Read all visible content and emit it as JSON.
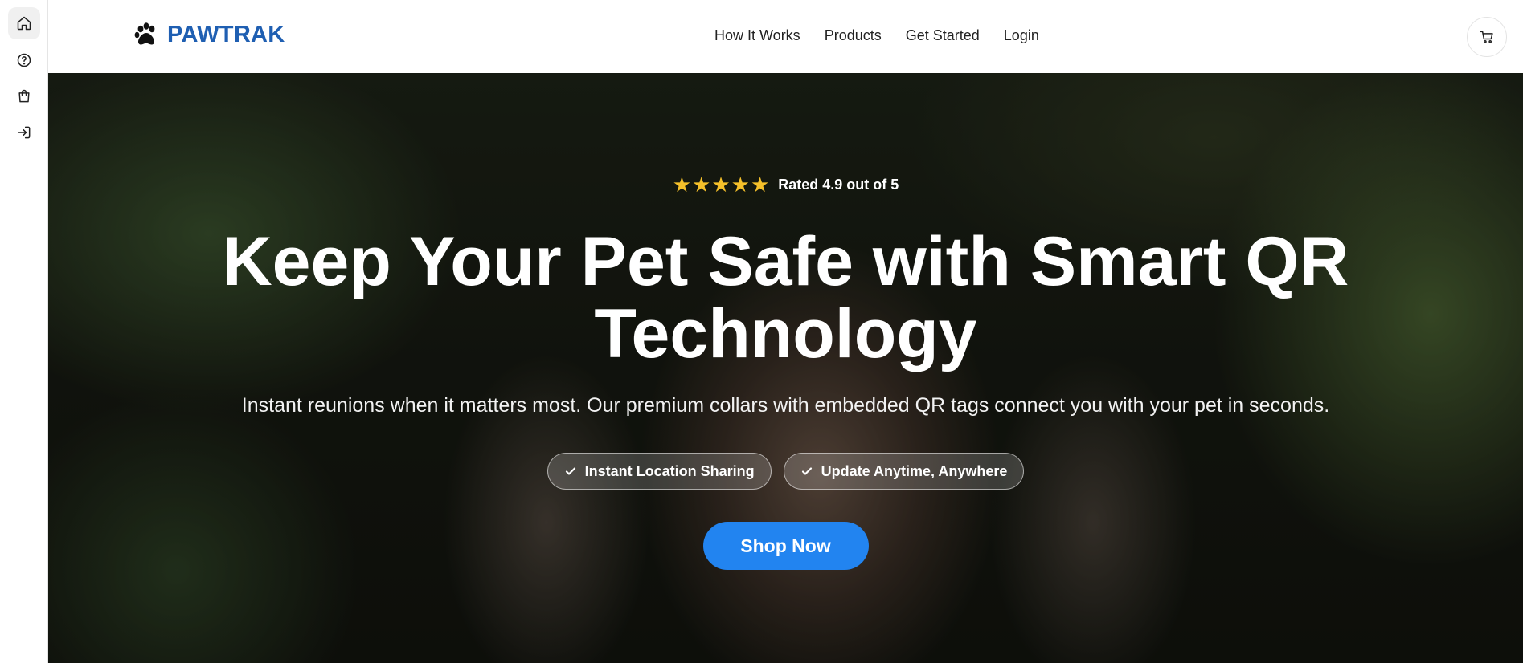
{
  "sidebar": {
    "items": [
      {
        "icon": "home-icon",
        "active": true
      },
      {
        "icon": "help-circle-icon",
        "active": false
      },
      {
        "icon": "shopping-bag-icon",
        "active": false
      },
      {
        "icon": "login-icon",
        "active": false
      }
    ]
  },
  "header": {
    "brand_name": "PAWTRAK",
    "brand_icon": "paw-icon",
    "brand_color": "#1f5fb2",
    "nav": [
      {
        "label": "How It Works"
      },
      {
        "label": "Products"
      },
      {
        "label": "Get Started"
      },
      {
        "label": "Login"
      }
    ],
    "cart_icon": "cart-icon"
  },
  "hero": {
    "rating": {
      "stars": "★★★★★",
      "value": 4.9,
      "out_of": 5,
      "text": "Rated 4.9 out of 5"
    },
    "headline_line1": "Keep Your Pet Safe with Smart QR",
    "headline_line2": "Technology",
    "subline": "Instant reunions when it matters most. Our premium collars with embedded QR tags connect you with your pet in seconds.",
    "features": [
      {
        "label": "Instant Location Sharing",
        "icon": "check-icon"
      },
      {
        "label": "Update Anytime, Anywhere",
        "icon": "check-icon"
      }
    ],
    "cta_label": "Shop Now",
    "cta_color": "#2284f0",
    "star_color": "#f5c02a"
  }
}
